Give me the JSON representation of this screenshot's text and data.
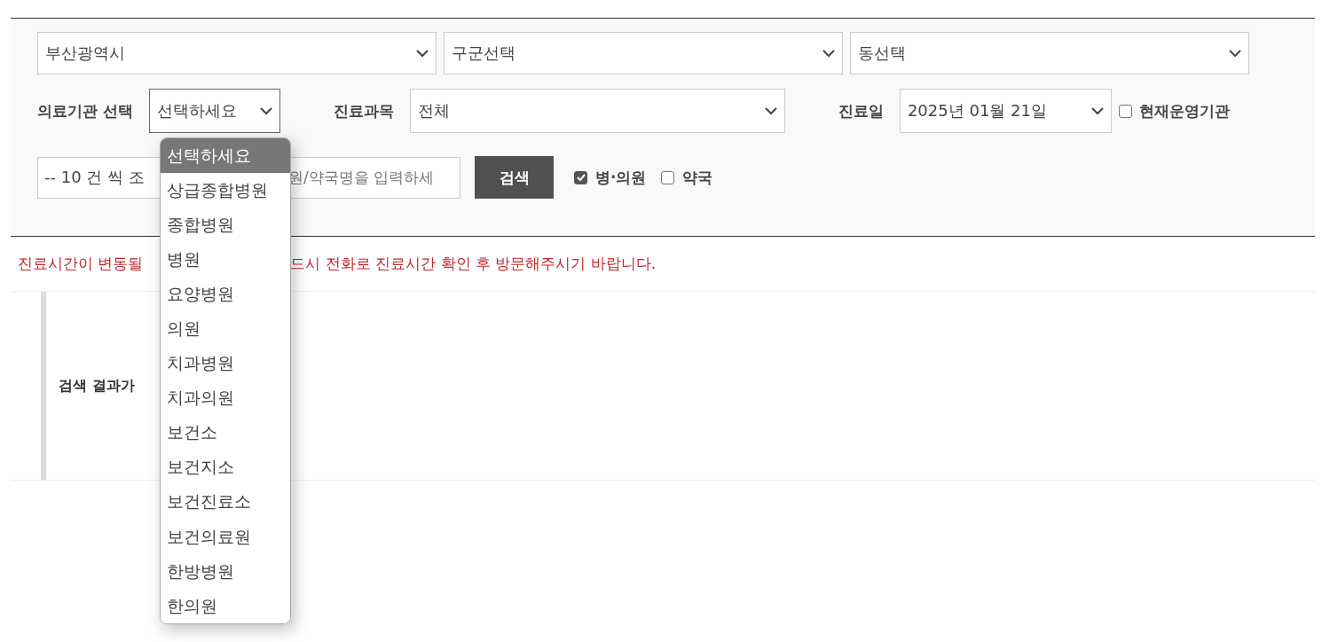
{
  "region_selects": [
    {
      "value": "부산광역시"
    },
    {
      "value": "구군선택"
    },
    {
      "value": "동선택"
    }
  ],
  "institution": {
    "label": "의료기관 선택",
    "value": "선택하세요",
    "expanded": true,
    "options": [
      {
        "label": "선택하세요",
        "selected": true
      },
      {
        "label": "상급종합병원",
        "selected": false
      },
      {
        "label": "종합병원",
        "selected": false
      },
      {
        "label": "병원",
        "selected": false
      },
      {
        "label": "요양병원",
        "selected": false
      },
      {
        "label": "의원",
        "selected": false
      },
      {
        "label": "치과병원",
        "selected": false
      },
      {
        "label": "치과의원",
        "selected": false
      },
      {
        "label": "보건소",
        "selected": false
      },
      {
        "label": "보건지소",
        "selected": false
      },
      {
        "label": "보건진료소",
        "selected": false
      },
      {
        "label": "보건의료원",
        "selected": false
      },
      {
        "label": "한방병원",
        "selected": false
      },
      {
        "label": "한의원",
        "selected": false
      }
    ]
  },
  "department": {
    "label": "진료과목",
    "value": "전체"
  },
  "date": {
    "label": "진료일",
    "value": "2025년 01월 21일"
  },
  "open_now": {
    "label": "현재운영기관",
    "checked": false
  },
  "page_size": {
    "value": "-- 10 건 씩 조"
  },
  "search": {
    "placeholder": "원/약국명을 입력하세",
    "button": "검색"
  },
  "types": [
    {
      "label": "병·의원",
      "checked": true
    },
    {
      "label": "약국",
      "checked": false
    }
  ],
  "notice": [
    "진료시간이 변동될",
    "드시 전화로 진료시간 확인 후 방문해주시기 바랍니다."
  ],
  "result": "검색 결과가"
}
